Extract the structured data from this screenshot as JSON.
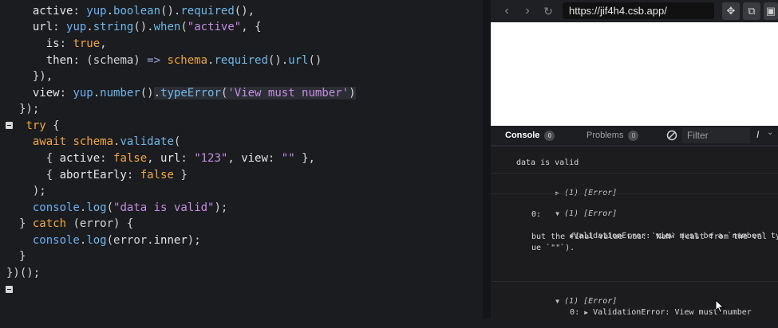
{
  "editor": {
    "lines": [
      {
        "html": "  <span class=\"v\">active</span>: <span class=\"t\">yup</span>.<span class=\"fn\">boolean</span>().<span class=\"fn\">required</span>(),"
      },
      {
        "html": "  <span class=\"v\">url</span>: <span class=\"t\">yup</span>.<span class=\"fn\">string</span>().<span class=\"fn\">when</span>(<span class=\"s\">\"active\"</span>, {"
      },
      {
        "html": "    <span class=\"v\">is</span>: <span class=\"k\">true</span>,"
      },
      {
        "html": "    <span class=\"v\">then</span>: (schema) <span class=\"p\">=&gt;</span> <span class=\"k\">schema</span>.<span class=\"fn\">required</span>().<span class=\"fn\">url</span>()"
      },
      {
        "html": "  }),"
      },
      {
        "html": "  <span class=\"v\">view</span>: <span class=\"t\">yup</span>.<span class=\"fn\">number</span>()<span class=\"hl\">.<span class=\"fn\">typeError</span>(<span class=\"s\">'View must number'</span>)</span>"
      },
      {
        "html": "});"
      },
      {
        "html": " <span class=\"k\">try</span> {"
      },
      {
        "html": "  <span class=\"k\">await</span> <span class=\"k\">schema</span>.<span class=\"fn\">validate</span>("
      },
      {
        "html": "    { <span class=\"v\">active</span>: <span class=\"k\">false</span>, <span class=\"v\">url</span>: <span class=\"s\">\"123\"</span>, <span class=\"v\">view</span>: <span class=\"s\">\"\"</span> },"
      },
      {
        "html": "    { <span class=\"v\">abortEarly</span>: <span class=\"k\">false</span> }"
      },
      {
        "html": "  );"
      },
      {
        "html": "  <span class=\"t\">console</span>.<span class=\"fn\">log</span>(<span class=\"s\">\"data is valid\"</span>);"
      },
      {
        "html": "} <span class=\"k\">catch</span> (error) {"
      },
      {
        "html": "  <span class=\"t\">console</span>.<span class=\"fn\">log</span>(error.<span class=\"v\">inner</span>);"
      },
      {
        "html": "}"
      },
      {
        "html": "})();"
      }
    ]
  },
  "browser": {
    "url": "https://jif4h4.csb.app/",
    "back_icon": "chevron-left-icon",
    "forward_icon": "chevron-right-icon",
    "reload_icon": "reload-icon"
  },
  "devtools": {
    "tab_console": "Console",
    "tab_console_count": "0",
    "tab_problems": "Problems",
    "tab_problems_count": "0",
    "filter_placeholder": "Filter"
  },
  "console": {
    "log1": "data is valid",
    "entry2": "(1) [Error]",
    "entry3_header": "(1) [Error]",
    "entry3_index": "0:",
    "entry3_line1": "ValidationError: view must be a `number` type,",
    "entry3_line2": "but the final value was: `NaN` (cast from the val",
    "entry3_line3": "ue `\"\"`).",
    "entry4_header": "(1) [Error]",
    "entry4_index": "0:",
    "entry4_line1": "ValidationError: View must number"
  }
}
